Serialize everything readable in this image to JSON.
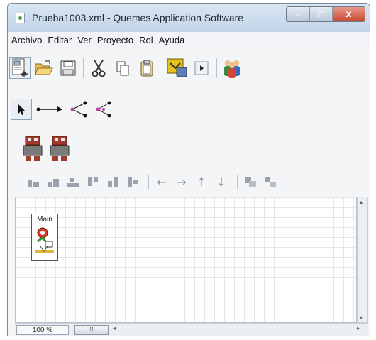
{
  "window": {
    "title": "Prueba1003.xml - Quemes Application Software",
    "buttons": {
      "minimize": "‒",
      "maximize": "□",
      "close": "x"
    }
  },
  "menu": {
    "items": [
      "Archivo",
      "Editar",
      "Ver",
      "Proyecto",
      "Rol",
      "Ayuda"
    ]
  },
  "toolbar_main": {
    "icons": [
      "new-diagram-icon",
      "open-folder-icon",
      "save-icon",
      "cut-icon",
      "copy-icon",
      "paste-icon",
      "validate-icon",
      "run-icon",
      "users-icon"
    ]
  },
  "toolbar_edges": {
    "icons": [
      "select-pointer-icon",
      "connection-icon",
      "fork-icon",
      "join-icon"
    ]
  },
  "toolbar_roles": {
    "icons": [
      "robot-role-icon",
      "robot-role-icon"
    ]
  },
  "toolbar_align": {
    "icons": [
      "align-left-icon",
      "align-center-icon",
      "align-right-icon",
      "align-top-icon",
      "align-middle-icon",
      "align-bottom-icon",
      "arrow-left-icon",
      "arrow-right-icon",
      "arrow-up-icon",
      "arrow-down-icon",
      "group-icon",
      "ungroup-icon"
    ]
  },
  "canvas": {
    "nodes": [
      {
        "label": "Main",
        "icon": "workflow-node-icon"
      }
    ]
  },
  "status": {
    "zoom": "100 %",
    "scroll_thumb": "⁞⁞",
    "scroll_left": "◂",
    "scroll_right": "▸"
  },
  "colors": {
    "titlebar": "#c2d4e8",
    "close_button": "#c64a33",
    "grid": "#e3e7ec",
    "accent_yellow": "#e6c31a"
  }
}
